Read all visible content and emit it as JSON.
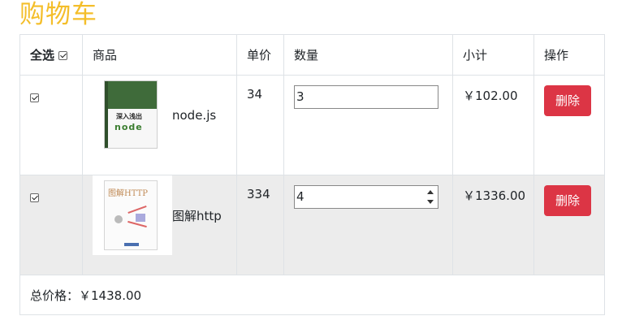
{
  "page": {
    "title": "购物车"
  },
  "table": {
    "headers": {
      "select_all": "全选",
      "product": "商品",
      "unit_price": "单价",
      "quantity": "数量",
      "subtotal": "小计",
      "action": "操作"
    },
    "items": [
      {
        "checked": true,
        "name": "node.js",
        "cover_text_1": "深入浅出",
        "cover_text_2": "node",
        "price": "34",
        "quantity": "3",
        "subtotal": "￥102.00",
        "delete_label": "删除"
      },
      {
        "checked": true,
        "name": "图解http",
        "cover_text_1": "图解HTTP",
        "price": "334",
        "quantity": "4",
        "subtotal": "￥1336.00",
        "delete_label": "删除"
      }
    ],
    "total_label": "总价格：",
    "total_value": "￥1438.00"
  },
  "colors": {
    "title": "#f4be2a",
    "delete_button": "#dc3545",
    "row_shade": "#ececec",
    "border": "#dee2e6"
  }
}
